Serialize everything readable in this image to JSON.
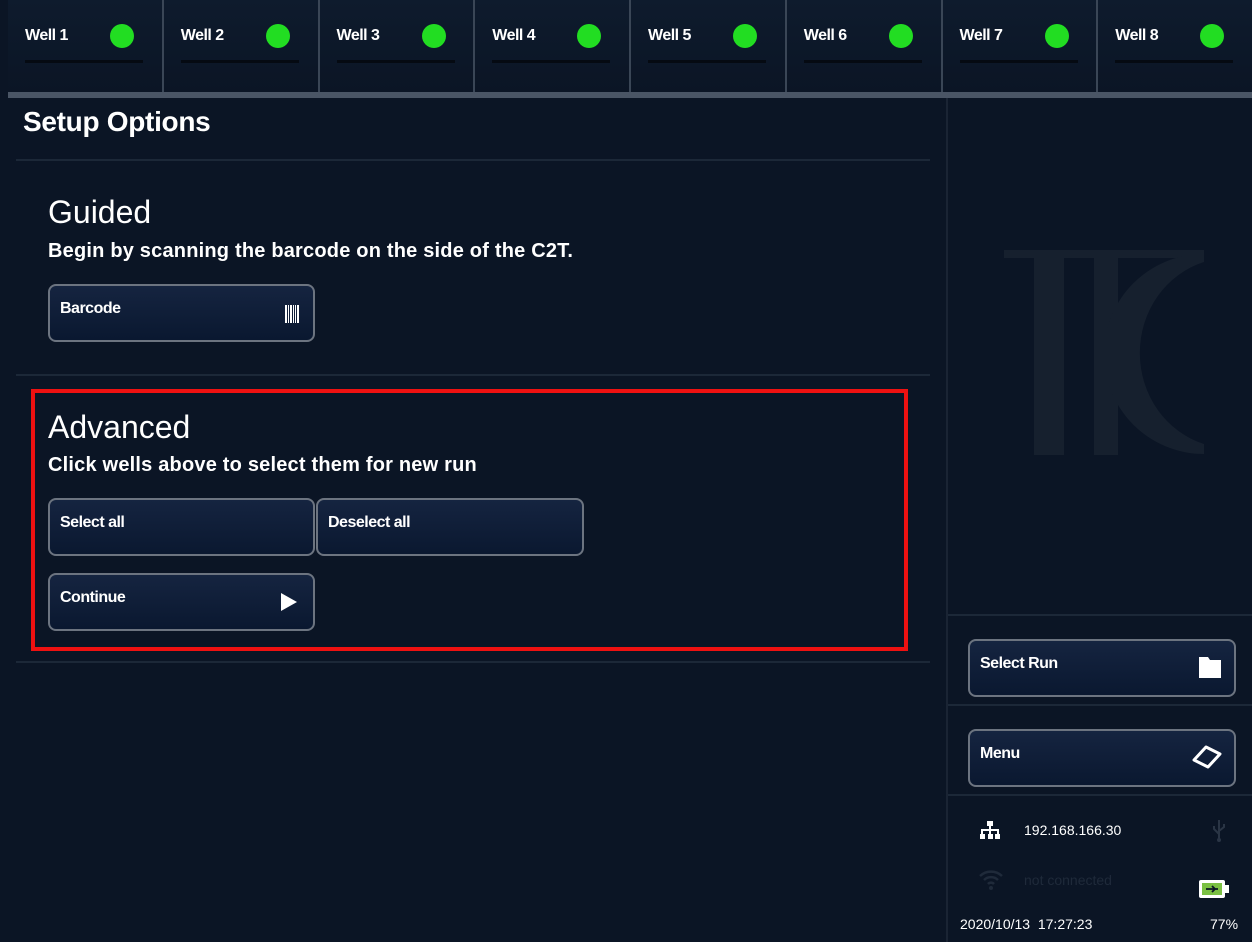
{
  "wells": [
    {
      "label": "Well 1",
      "status_color": "#22dd22"
    },
    {
      "label": "Well 2",
      "status_color": "#22dd22"
    },
    {
      "label": "Well 3",
      "status_color": "#22dd22"
    },
    {
      "label": "Well 4",
      "status_color": "#22dd22"
    },
    {
      "label": "Well 5",
      "status_color": "#22dd22"
    },
    {
      "label": "Well 6",
      "status_color": "#22dd22"
    },
    {
      "label": "Well 7",
      "status_color": "#22dd22"
    },
    {
      "label": "Well 8",
      "status_color": "#22dd22"
    }
  ],
  "main": {
    "title": "Setup Options",
    "guided": {
      "title": "Guided",
      "subtitle": "Begin by scanning the barcode on the side of the C2T.",
      "barcode_button": "Barcode",
      "barcode_icon": "barcode-icon"
    },
    "advanced": {
      "title": "Advanced",
      "subtitle": "Click wells above to select them for new run",
      "select_all": "Select all",
      "deselect_all": "Deselect all",
      "continue": "Continue",
      "continue_icon": "play-icon"
    }
  },
  "side": {
    "logo_icon": "tc-logo",
    "select_run": "Select Run",
    "select_run_icon": "folder-icon",
    "menu": "Menu",
    "menu_icon": "tablet-icon",
    "network_icon": "network-icon",
    "ip_address": "192.168.166.30",
    "usb_icon": "usb-icon",
    "wifi_icon": "wifi-icon",
    "wifi_status": "not connected",
    "date": "2020/10/13",
    "time": "17:27:23",
    "battery_icon": "battery-icon",
    "battery_percent": "77%"
  },
  "colors": {
    "background": "#0b1525",
    "well_ok": "#22dd22",
    "highlight": "#ee1111",
    "battery_fill": "#7bc043"
  }
}
